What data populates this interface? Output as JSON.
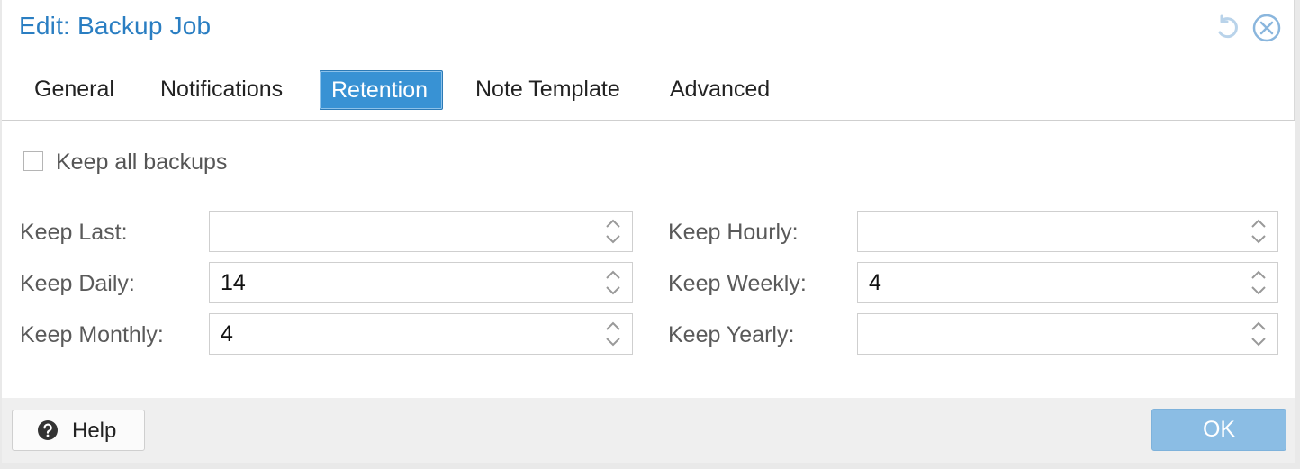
{
  "window": {
    "title": "Edit: Backup Job",
    "accent_color": "#2a7ec2",
    "toolbar": [
      {
        "icon": "reset-icon"
      },
      {
        "icon": "close-icon"
      }
    ]
  },
  "tabs": [
    {
      "label": "General",
      "active": false
    },
    {
      "label": "Notifications",
      "active": false
    },
    {
      "label": "Retention",
      "active": true
    },
    {
      "label": "Note Template",
      "active": false
    },
    {
      "label": "Advanced",
      "active": false
    }
  ],
  "retention": {
    "keep_all": {
      "label": "Keep all backups",
      "checked": false
    },
    "fields": {
      "keep_last": {
        "label": "Keep Last:",
        "value": ""
      },
      "keep_hourly": {
        "label": "Keep Hourly:",
        "value": ""
      },
      "keep_daily": {
        "label": "Keep Daily:",
        "value": "14"
      },
      "keep_weekly": {
        "label": "Keep Weekly:",
        "value": "4"
      },
      "keep_monthly": {
        "label": "Keep Monthly:",
        "value": "4"
      },
      "keep_yearly": {
        "label": "Keep Yearly:",
        "value": ""
      }
    }
  },
  "footer": {
    "help_label": "Help",
    "ok_label": "OK",
    "ok_enabled": false,
    "ok_color": "#8bbde4"
  }
}
